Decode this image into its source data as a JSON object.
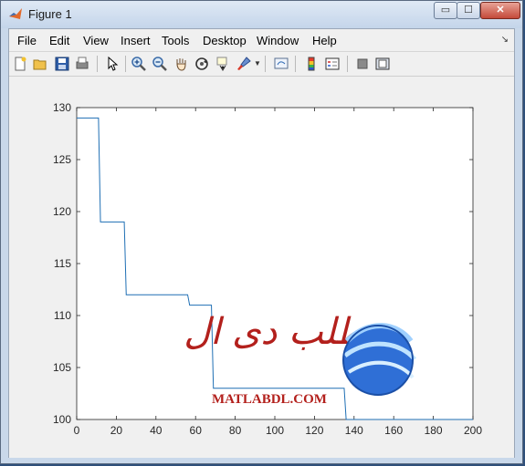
{
  "window": {
    "title": "Figure 1",
    "controls": {
      "minimize": "▭",
      "maximize": "☐",
      "close": "✕"
    }
  },
  "menubar": {
    "items": [
      "File",
      "Edit",
      "View",
      "Insert",
      "Tools",
      "Desktop",
      "Window",
      "Help"
    ],
    "arrow": "↘"
  },
  "toolbar": {
    "icons": [
      "new-figure-icon",
      "open-file-icon",
      "save-icon",
      "print-icon",
      "edit-plot-arrow-icon",
      "zoom-in-icon",
      "zoom-out-icon",
      "pan-hand-icon",
      "rotate-3d-icon",
      "data-cursor-icon",
      "brush-icon",
      "link-plot-icon",
      "colorbar-icon",
      "legend-icon",
      "hide-plot-tools-icon",
      "show-plot-tools-icon"
    ]
  },
  "watermark": {
    "arabic": "مطلب دی ال",
    "latin": "MATLABDL.COM",
    "colors": {
      "text": "#b3201c",
      "globe": "#2f6fd6"
    }
  },
  "chart_data": {
    "type": "line",
    "title": "",
    "xlabel": "",
    "ylabel": "",
    "xlim": [
      0,
      200
    ],
    "ylim": [
      100,
      130
    ],
    "xticks": [
      0,
      20,
      40,
      60,
      80,
      100,
      120,
      140,
      160,
      180,
      200
    ],
    "yticks": [
      100,
      105,
      110,
      115,
      120,
      125,
      130
    ],
    "grid": false,
    "line_color": "#1f6fb4",
    "series": [
      {
        "x": [
          0,
          11,
          12,
          24,
          25,
          56,
          57,
          68,
          69,
          135,
          136,
          200
        ],
        "y": [
          129,
          129,
          119,
          119,
          112,
          112,
          111,
          111,
          103,
          103,
          100,
          100
        ]
      }
    ]
  }
}
